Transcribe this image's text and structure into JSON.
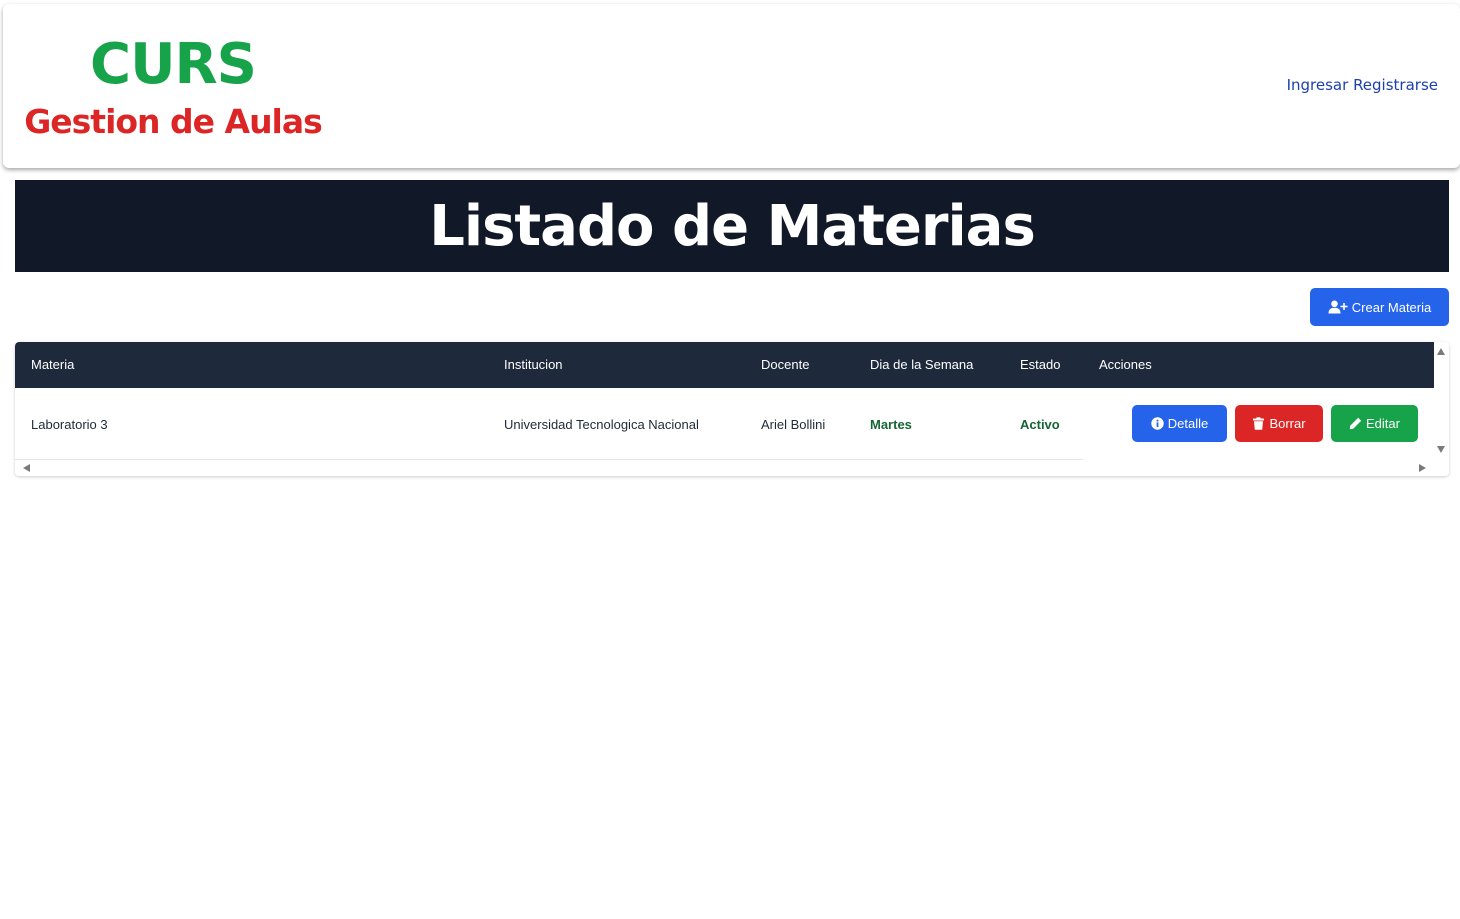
{
  "brand": {
    "title": "CURS",
    "subtitle": "Gestion de Aulas"
  },
  "nav": {
    "login": "Ingresar",
    "register": "Registrarse"
  },
  "page": {
    "heading": "Listado de Materias"
  },
  "toolbar": {
    "create_label": "Crear Materia",
    "create_icon": "user-plus-icon"
  },
  "table": {
    "columns": [
      "Materia",
      "Institucion",
      "Docente",
      "Dia de la Semana",
      "Estado",
      "Acciones"
    ],
    "rows": [
      {
        "materia": "Laboratorio 3",
        "institucion": "Universidad Tecnologica Nacional",
        "docente": "Ariel Bollini",
        "dia": "Martes",
        "estado": "Activo",
        "actions": {
          "detalle": "Detalle",
          "borrar": "Borrar",
          "editar": "Editar"
        }
      }
    ]
  },
  "colors": {
    "brand_green": "#16a34a",
    "brand_red": "#dc2626",
    "banner_bg": "#111827",
    "table_header_bg": "#1e293b",
    "primary_blue": "#2563eb",
    "status_green": "#166534"
  }
}
